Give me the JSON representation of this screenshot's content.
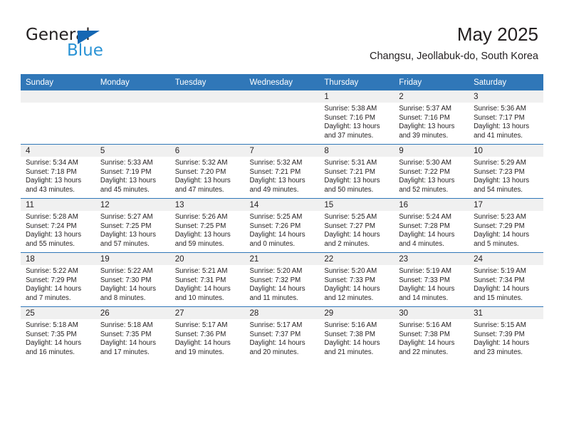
{
  "brand": {
    "name_top": "General",
    "name_bottom": "Blue",
    "triangle_color": "#1567b3",
    "blue_color": "#2a93d5"
  },
  "header": {
    "title": "May 2025",
    "subtitle": "Changsu, Jeollabuk-do, South Korea"
  },
  "theme": {
    "header_bg": "#3077B8",
    "daynum_bg": "#F0F0F0",
    "text": "#231f20"
  },
  "weekdays": [
    "Sunday",
    "Monday",
    "Tuesday",
    "Wednesday",
    "Thursday",
    "Friday",
    "Saturday"
  ],
  "weeks": [
    [
      {
        "day": "",
        "empty": true
      },
      {
        "day": "",
        "empty": true
      },
      {
        "day": "",
        "empty": true
      },
      {
        "day": "",
        "empty": true
      },
      {
        "day": "1",
        "sunrise": "Sunrise: 5:38 AM",
        "sunset": "Sunset: 7:16 PM",
        "daylight1": "Daylight: 13 hours",
        "daylight2": "and 37 minutes."
      },
      {
        "day": "2",
        "sunrise": "Sunrise: 5:37 AM",
        "sunset": "Sunset: 7:16 PM",
        "daylight1": "Daylight: 13 hours",
        "daylight2": "and 39 minutes."
      },
      {
        "day": "3",
        "sunrise": "Sunrise: 5:36 AM",
        "sunset": "Sunset: 7:17 PM",
        "daylight1": "Daylight: 13 hours",
        "daylight2": "and 41 minutes."
      }
    ],
    [
      {
        "day": "4",
        "sunrise": "Sunrise: 5:34 AM",
        "sunset": "Sunset: 7:18 PM",
        "daylight1": "Daylight: 13 hours",
        "daylight2": "and 43 minutes."
      },
      {
        "day": "5",
        "sunrise": "Sunrise: 5:33 AM",
        "sunset": "Sunset: 7:19 PM",
        "daylight1": "Daylight: 13 hours",
        "daylight2": "and 45 minutes."
      },
      {
        "day": "6",
        "sunrise": "Sunrise: 5:32 AM",
        "sunset": "Sunset: 7:20 PM",
        "daylight1": "Daylight: 13 hours",
        "daylight2": "and 47 minutes."
      },
      {
        "day": "7",
        "sunrise": "Sunrise: 5:32 AM",
        "sunset": "Sunset: 7:21 PM",
        "daylight1": "Daylight: 13 hours",
        "daylight2": "and 49 minutes."
      },
      {
        "day": "8",
        "sunrise": "Sunrise: 5:31 AM",
        "sunset": "Sunset: 7:21 PM",
        "daylight1": "Daylight: 13 hours",
        "daylight2": "and 50 minutes."
      },
      {
        "day": "9",
        "sunrise": "Sunrise: 5:30 AM",
        "sunset": "Sunset: 7:22 PM",
        "daylight1": "Daylight: 13 hours",
        "daylight2": "and 52 minutes."
      },
      {
        "day": "10",
        "sunrise": "Sunrise: 5:29 AM",
        "sunset": "Sunset: 7:23 PM",
        "daylight1": "Daylight: 13 hours",
        "daylight2": "and 54 minutes."
      }
    ],
    [
      {
        "day": "11",
        "sunrise": "Sunrise: 5:28 AM",
        "sunset": "Sunset: 7:24 PM",
        "daylight1": "Daylight: 13 hours",
        "daylight2": "and 55 minutes."
      },
      {
        "day": "12",
        "sunrise": "Sunrise: 5:27 AM",
        "sunset": "Sunset: 7:25 PM",
        "daylight1": "Daylight: 13 hours",
        "daylight2": "and 57 minutes."
      },
      {
        "day": "13",
        "sunrise": "Sunrise: 5:26 AM",
        "sunset": "Sunset: 7:25 PM",
        "daylight1": "Daylight: 13 hours",
        "daylight2": "and 59 minutes."
      },
      {
        "day": "14",
        "sunrise": "Sunrise: 5:25 AM",
        "sunset": "Sunset: 7:26 PM",
        "daylight1": "Daylight: 14 hours",
        "daylight2": "and 0 minutes."
      },
      {
        "day": "15",
        "sunrise": "Sunrise: 5:25 AM",
        "sunset": "Sunset: 7:27 PM",
        "daylight1": "Daylight: 14 hours",
        "daylight2": "and 2 minutes."
      },
      {
        "day": "16",
        "sunrise": "Sunrise: 5:24 AM",
        "sunset": "Sunset: 7:28 PM",
        "daylight1": "Daylight: 14 hours",
        "daylight2": "and 4 minutes."
      },
      {
        "day": "17",
        "sunrise": "Sunrise: 5:23 AM",
        "sunset": "Sunset: 7:29 PM",
        "daylight1": "Daylight: 14 hours",
        "daylight2": "and 5 minutes."
      }
    ],
    [
      {
        "day": "18",
        "sunrise": "Sunrise: 5:22 AM",
        "sunset": "Sunset: 7:29 PM",
        "daylight1": "Daylight: 14 hours",
        "daylight2": "and 7 minutes."
      },
      {
        "day": "19",
        "sunrise": "Sunrise: 5:22 AM",
        "sunset": "Sunset: 7:30 PM",
        "daylight1": "Daylight: 14 hours",
        "daylight2": "and 8 minutes."
      },
      {
        "day": "20",
        "sunrise": "Sunrise: 5:21 AM",
        "sunset": "Sunset: 7:31 PM",
        "daylight1": "Daylight: 14 hours",
        "daylight2": "and 10 minutes."
      },
      {
        "day": "21",
        "sunrise": "Sunrise: 5:20 AM",
        "sunset": "Sunset: 7:32 PM",
        "daylight1": "Daylight: 14 hours",
        "daylight2": "and 11 minutes."
      },
      {
        "day": "22",
        "sunrise": "Sunrise: 5:20 AM",
        "sunset": "Sunset: 7:33 PM",
        "daylight1": "Daylight: 14 hours",
        "daylight2": "and 12 minutes."
      },
      {
        "day": "23",
        "sunrise": "Sunrise: 5:19 AM",
        "sunset": "Sunset: 7:33 PM",
        "daylight1": "Daylight: 14 hours",
        "daylight2": "and 14 minutes."
      },
      {
        "day": "24",
        "sunrise": "Sunrise: 5:19 AM",
        "sunset": "Sunset: 7:34 PM",
        "daylight1": "Daylight: 14 hours",
        "daylight2": "and 15 minutes."
      }
    ],
    [
      {
        "day": "25",
        "sunrise": "Sunrise: 5:18 AM",
        "sunset": "Sunset: 7:35 PM",
        "daylight1": "Daylight: 14 hours",
        "daylight2": "and 16 minutes."
      },
      {
        "day": "26",
        "sunrise": "Sunrise: 5:18 AM",
        "sunset": "Sunset: 7:35 PM",
        "daylight1": "Daylight: 14 hours",
        "daylight2": "and 17 minutes."
      },
      {
        "day": "27",
        "sunrise": "Sunrise: 5:17 AM",
        "sunset": "Sunset: 7:36 PM",
        "daylight1": "Daylight: 14 hours",
        "daylight2": "and 19 minutes."
      },
      {
        "day": "28",
        "sunrise": "Sunrise: 5:17 AM",
        "sunset": "Sunset: 7:37 PM",
        "daylight1": "Daylight: 14 hours",
        "daylight2": "and 20 minutes."
      },
      {
        "day": "29",
        "sunrise": "Sunrise: 5:16 AM",
        "sunset": "Sunset: 7:38 PM",
        "daylight1": "Daylight: 14 hours",
        "daylight2": "and 21 minutes."
      },
      {
        "day": "30",
        "sunrise": "Sunrise: 5:16 AM",
        "sunset": "Sunset: 7:38 PM",
        "daylight1": "Daylight: 14 hours",
        "daylight2": "and 22 minutes."
      },
      {
        "day": "31",
        "sunrise": "Sunrise: 5:15 AM",
        "sunset": "Sunset: 7:39 PM",
        "daylight1": "Daylight: 14 hours",
        "daylight2": "and 23 minutes."
      }
    ]
  ]
}
